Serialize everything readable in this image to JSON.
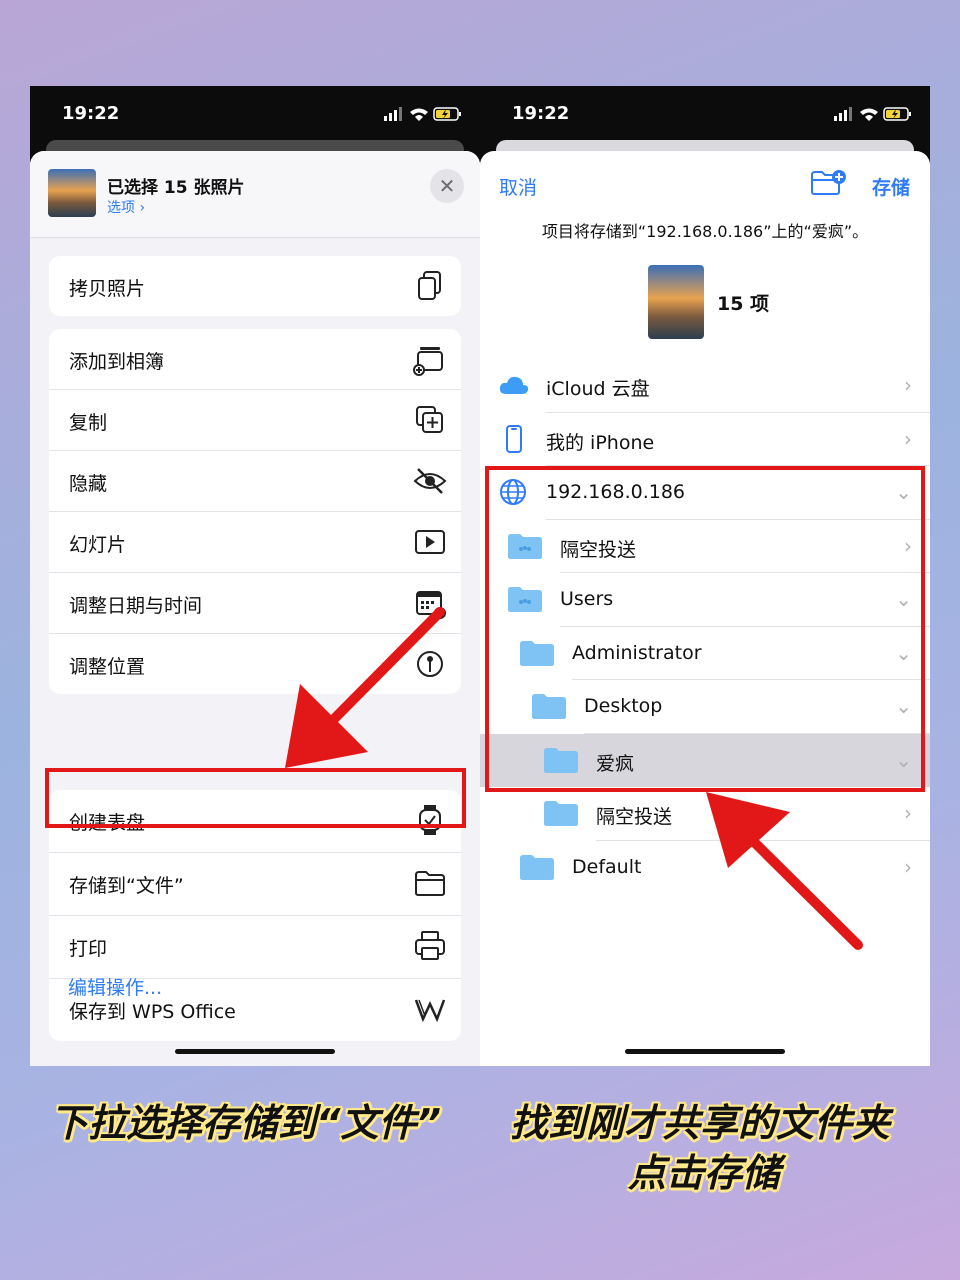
{
  "status": {
    "time": "19:22"
  },
  "left": {
    "title": "已选择 15 张照片",
    "options_link": "选项 ›",
    "close": "✕",
    "group1": [
      {
        "label": "拷贝照片",
        "icon": "copy-photos-icon"
      }
    ],
    "group2": [
      {
        "label": "添加到相簿",
        "icon": "add-album-icon"
      },
      {
        "label": "复制",
        "icon": "duplicate-icon"
      },
      {
        "label": "隐藏",
        "icon": "hide-eye-icon"
      },
      {
        "label": "幻灯片",
        "icon": "slideshow-play-icon"
      },
      {
        "label": "调整日期与时间",
        "icon": "calendar-clock-icon"
      },
      {
        "label": "调整位置",
        "icon": "location-pin-icon"
      }
    ],
    "group3": [
      {
        "label": "创建表盘",
        "icon": "watch-icon"
      },
      {
        "label": "存储到“文件”",
        "icon": "folder-icon"
      },
      {
        "label": "打印",
        "icon": "printer-icon"
      },
      {
        "label": "保存到 WPS Office",
        "icon": "wps-icon"
      }
    ],
    "edit_actions": "编辑操作..."
  },
  "right": {
    "cancel": "取消",
    "save": "存储",
    "message": "项目将存储到“192.168.0.186”上的“爱疯”。",
    "item_count": "15 项",
    "tree": [
      {
        "label": "iCloud 云盘",
        "icon": "icloud-icon",
        "chevron": "›"
      },
      {
        "label": "我的 iPhone",
        "icon": "iphone-icon",
        "chevron": "›"
      },
      {
        "label": "192.168.0.186",
        "icon": "globe-icon",
        "chevron": "⌄"
      },
      {
        "label": "隔空投送",
        "icon": "shared-folder-icon",
        "chevron": "›"
      },
      {
        "label": "Users",
        "icon": "shared-folder-icon",
        "chevron": "⌄"
      },
      {
        "label": "Administrator",
        "icon": "folder-icon",
        "chevron": "⌄"
      },
      {
        "label": "Desktop",
        "icon": "folder-icon",
        "chevron": "⌄"
      },
      {
        "label": "爱疯",
        "icon": "folder-icon",
        "chevron": "⌄",
        "selected": true
      },
      {
        "label": "隔空投送",
        "icon": "folder-icon",
        "chevron": "›"
      },
      {
        "label": "Default",
        "icon": "folder-icon",
        "chevron": "›"
      }
    ]
  },
  "captions": {
    "left": "下拉选择存储到“文件”",
    "right_line1": "找到刚才共享的文件夹",
    "right_line2": "点击存储"
  },
  "colors": {
    "accent": "#2f7cf6",
    "highlight": "#e21818",
    "caption_glow": "#ffe98a"
  }
}
